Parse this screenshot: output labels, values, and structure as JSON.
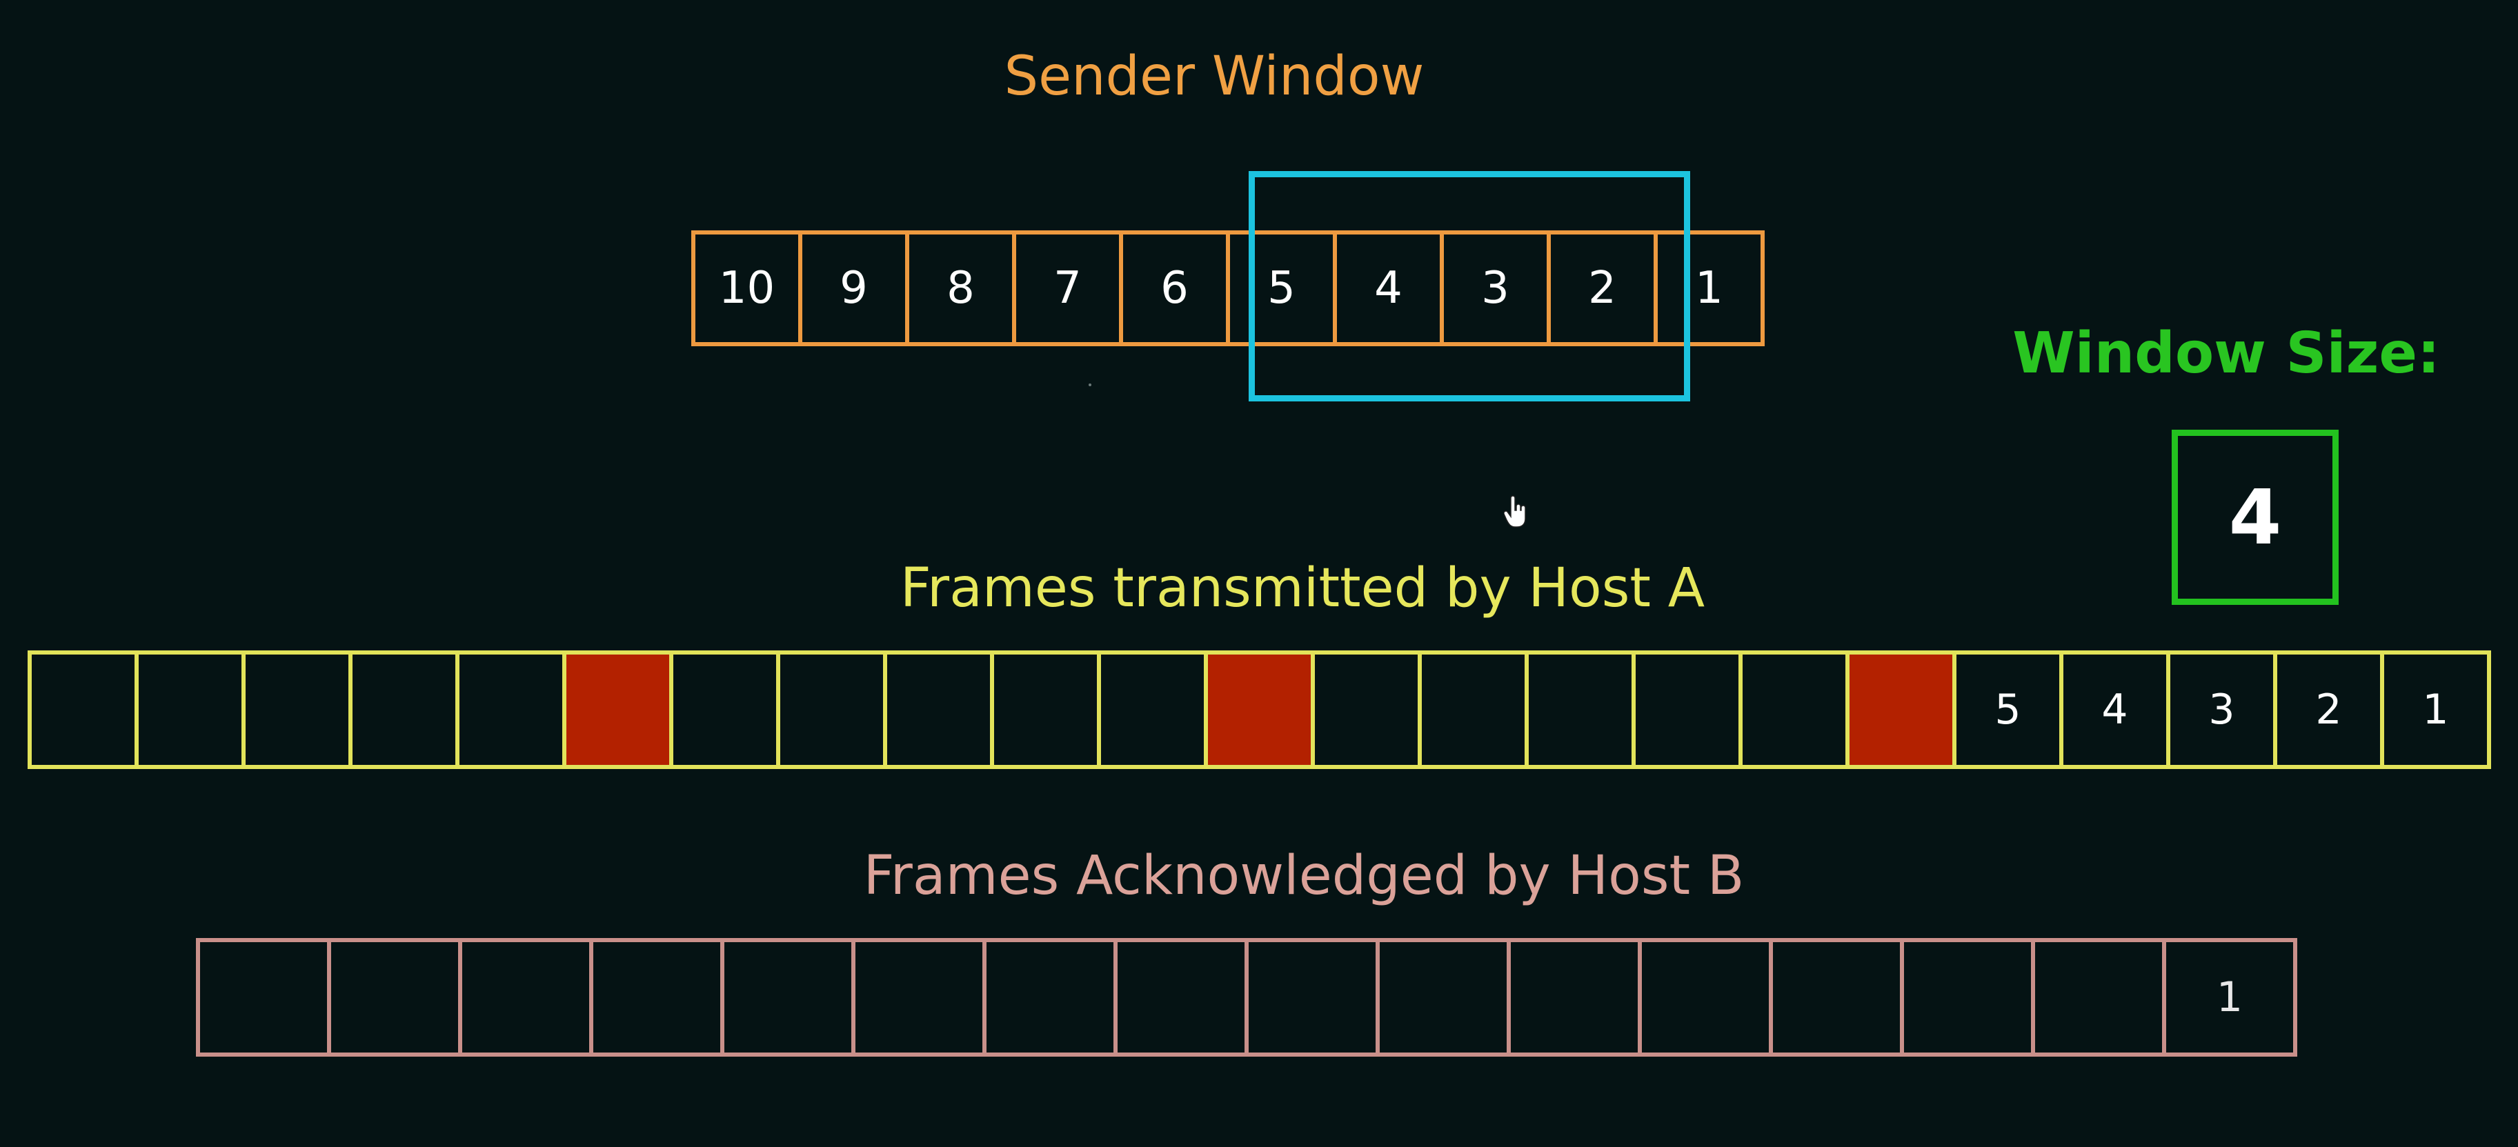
{
  "sender_window": {
    "title": "Sender Window",
    "frames": [
      "10",
      "9",
      "8",
      "7",
      "6",
      "5",
      "4",
      "3",
      "2",
      "1"
    ]
  },
  "window_size": {
    "label": "Window Size:",
    "value": "4"
  },
  "host_a": {
    "title": "Frames transmitted by Host A",
    "frames": [
      {
        "label": "",
        "lost": false
      },
      {
        "label": "",
        "lost": false
      },
      {
        "label": "",
        "lost": false
      },
      {
        "label": "",
        "lost": false
      },
      {
        "label": "",
        "lost": false
      },
      {
        "label": "",
        "lost": true
      },
      {
        "label": "",
        "lost": false
      },
      {
        "label": "",
        "lost": false
      },
      {
        "label": "",
        "lost": false
      },
      {
        "label": "",
        "lost": false
      },
      {
        "label": "",
        "lost": false
      },
      {
        "label": "",
        "lost": true
      },
      {
        "label": "",
        "lost": false
      },
      {
        "label": "",
        "lost": false
      },
      {
        "label": "",
        "lost": false
      },
      {
        "label": "",
        "lost": false
      },
      {
        "label": "",
        "lost": false
      },
      {
        "label": "",
        "lost": true
      },
      {
        "label": "5",
        "lost": false
      },
      {
        "label": "4",
        "lost": false
      },
      {
        "label": "3",
        "lost": false
      },
      {
        "label": "2",
        "lost": false
      },
      {
        "label": "1",
        "lost": false
      }
    ]
  },
  "host_b": {
    "title": "Frames Acknowledged by Host B",
    "frames": [
      "",
      "",
      "",
      "",
      "",
      "",
      "",
      "",
      "",
      "",
      "",
      "",
      "",
      "",
      "",
      "1"
    ]
  },
  "colors": {
    "background": "#051314",
    "sender": "#ee9a40",
    "window_frame": "#1cc3df",
    "window_size": "#23c21f",
    "host_a": "#e2e35a",
    "lost_frame": "#b32100",
    "host_b": "#c9908a"
  }
}
